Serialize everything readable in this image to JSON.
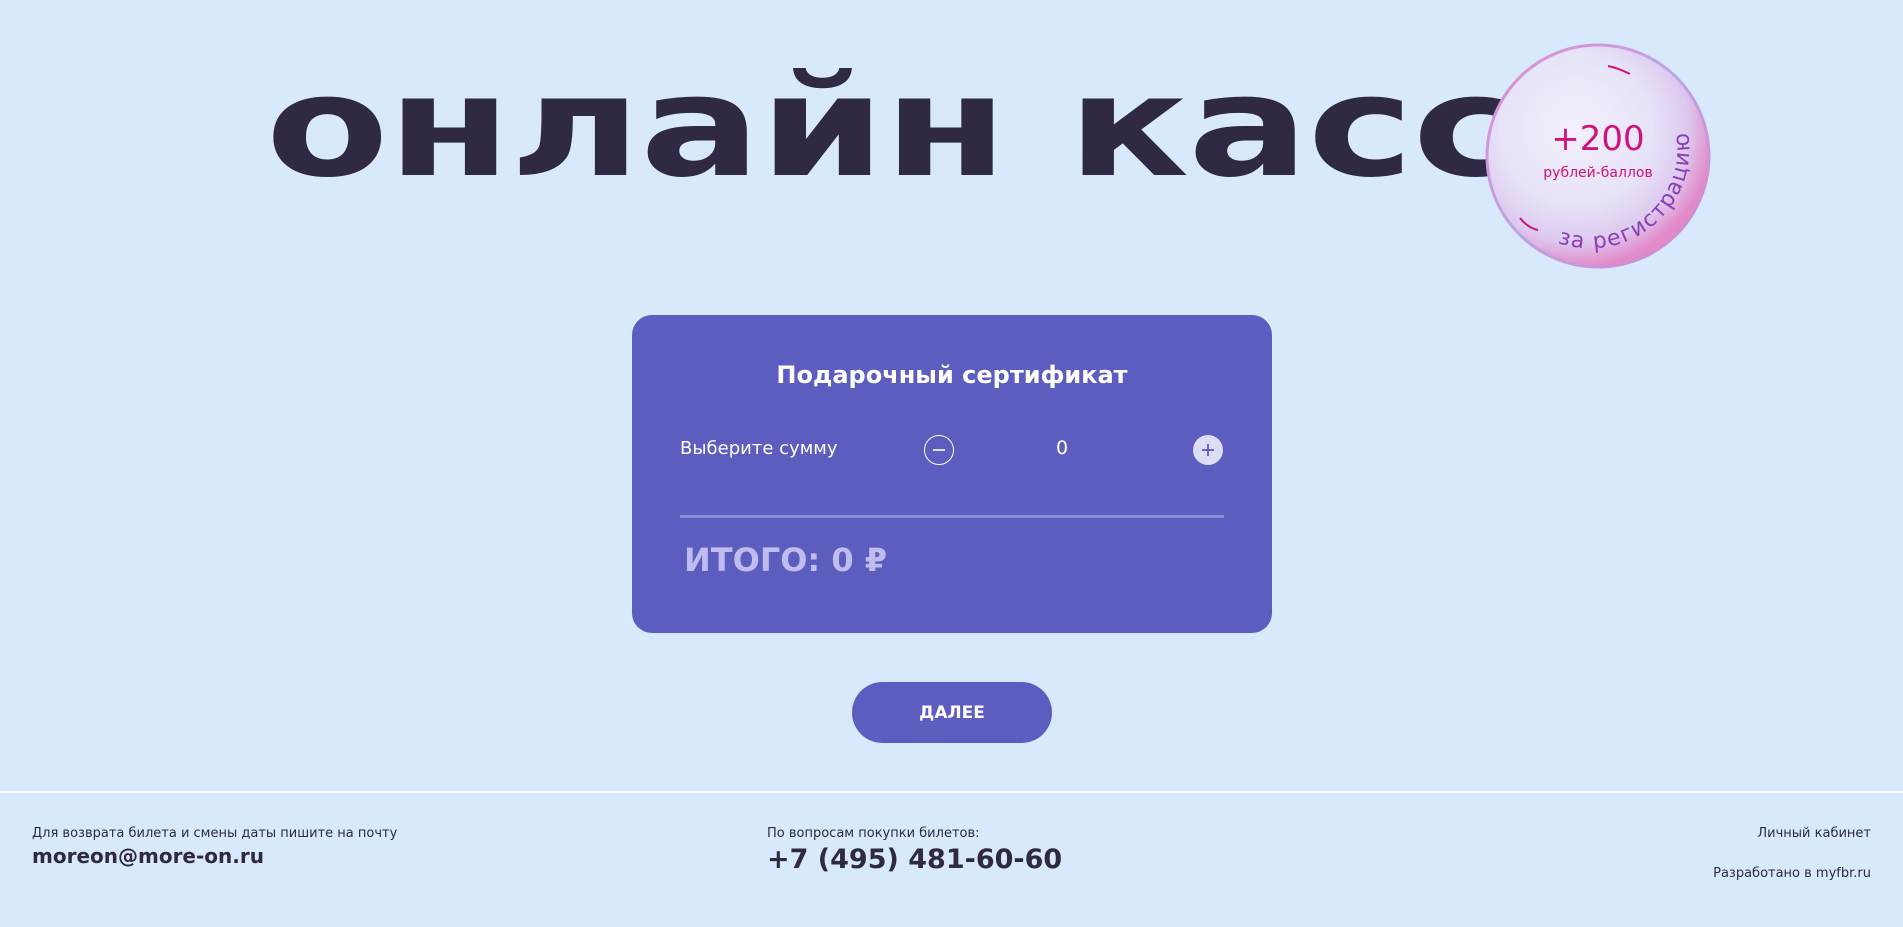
{
  "hero": {
    "title": "онлайн касса"
  },
  "promo": {
    "amount": "+200",
    "unit": "рублей-баллов",
    "arc_text": "за регистрацию",
    "color": "#d1127b"
  },
  "certificate": {
    "title": "Подарочный сертификат",
    "amount_label": "Выберите сумму",
    "quantity": "0",
    "minus_icon": "minus-circle-icon",
    "plus_icon": "plus-circle-icon",
    "total": "ИТОГО: 0 ₽",
    "background": "#5d5cbf"
  },
  "actions": {
    "next_label": "ДАЛЕЕ"
  },
  "footer": {
    "refund_note": "Для возврата билета и смены даты пишите на почту",
    "email": "moreon@more-on.ru",
    "purchase_note": "По вопросам покупки билетов:",
    "phone": "+7 (495) 481-60-60",
    "account_link": "Личный кабинет",
    "developer_credit": "Разработано в myfbr.ru"
  },
  "colors": {
    "page_background": "#d9e9fc",
    "text_dark": "#2f2944",
    "accent": "#5d5cbf"
  }
}
